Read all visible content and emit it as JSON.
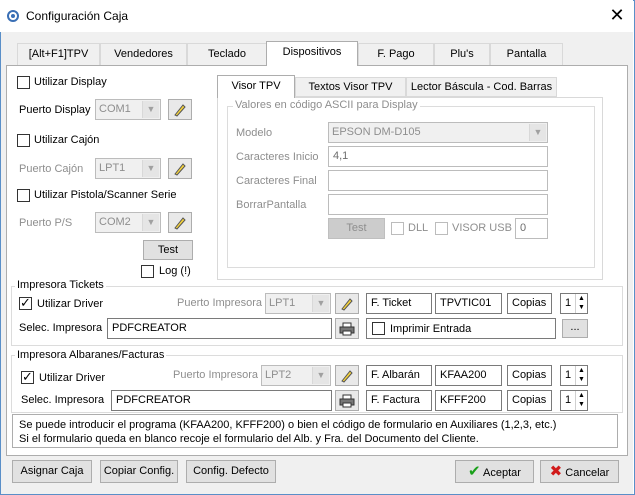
{
  "window": {
    "title": "Configuración Caja",
    "close_symbol": "✕"
  },
  "tabs": [
    {
      "label": "[Alt+F1]TPV"
    },
    {
      "label": "Vendedores"
    },
    {
      "label": "Teclado"
    },
    {
      "label": "Dispositivos",
      "active": true
    },
    {
      "label": "F. Pago"
    },
    {
      "label": "Plu's"
    },
    {
      "label": "Pantalla"
    }
  ],
  "left": {
    "use_display": "Utilizar Display",
    "display_port_label": "Puerto Display",
    "display_port_value": "COM1",
    "use_drawer": "Utilizar Cajón",
    "drawer_port_label": "Puerto Cajón",
    "drawer_port_value": "LPT1",
    "use_scanner": "Utilizar Pistola/Scanner Serie",
    "ps_port_label": "Puerto P/S",
    "ps_port_value": "COM2",
    "test_button": "Test",
    "log_label": "Log (!)"
  },
  "subtabs": [
    {
      "label": "Visor TPV",
      "active": true
    },
    {
      "label": "Textos Visor TPV"
    },
    {
      "label": "Lector Báscula - Cod. Barras"
    }
  ],
  "visor": {
    "group_title": "Valores en código ASCII para Display",
    "model_label": "Modelo",
    "model_value": "EPSON DM-D105",
    "start_chars_label": "Caracteres Inicio",
    "start_chars_value": "4,1",
    "end_chars_label": "Caracteres Final",
    "end_chars_value": "",
    "clear_label": "BorrarPantalla",
    "clear_value": "",
    "test_button": "Test",
    "dll_label": "DLL",
    "visor_usb_label": "VISOR USB",
    "visor_usb_value": "0"
  },
  "tickets": {
    "group_title": "Impresora Tickets",
    "use_driver": "Utilizar Driver",
    "port_label": "Puerto Impresora",
    "port_value": "LPT1",
    "ticket_label": "F. Ticket",
    "ticket_value": "TPVTIC01",
    "copies_label": "Copias",
    "copies_value": "1",
    "select_label": "Selec. Impresora",
    "printer_value": "PDFCREATOR",
    "print_entry": "Imprimir Entrada",
    "browse_button": "..."
  },
  "albaranes": {
    "group_title": "Impresora Albaranes/Facturas",
    "use_driver": "Utilizar Driver",
    "port_label": "Puerto Impresora",
    "port_value": "LPT2",
    "albaran_label": "F. Albarán",
    "albaran_value": "KFAA200",
    "copies_label": "Copias",
    "copies_value_1": "1",
    "select_label": "Selec. Impresora",
    "printer_value": "PDFCREATOR",
    "factura_label": "F. Factura",
    "factura_value": "KFFF200",
    "copies_value_2": "1"
  },
  "note": {
    "line1": "Se puede introducir el programa (KFAA200, KFFF200) o bien el código de formulario en Auxiliares (1,2,3, etc.)",
    "line2": "Si el formulario queda en blanco recoje el formulario del Alb. y Fra. del Documento del Cliente."
  },
  "footer": {
    "assign": "Asignar Caja",
    "copy": "Copiar Config.",
    "default": "Config. Defecto",
    "accept": "Aceptar",
    "cancel": "Cancelar"
  },
  "colors": {
    "accept_icon": "#1aa01a",
    "cancel_icon": "#d11a1a",
    "title_border": "#5a8fc8"
  }
}
